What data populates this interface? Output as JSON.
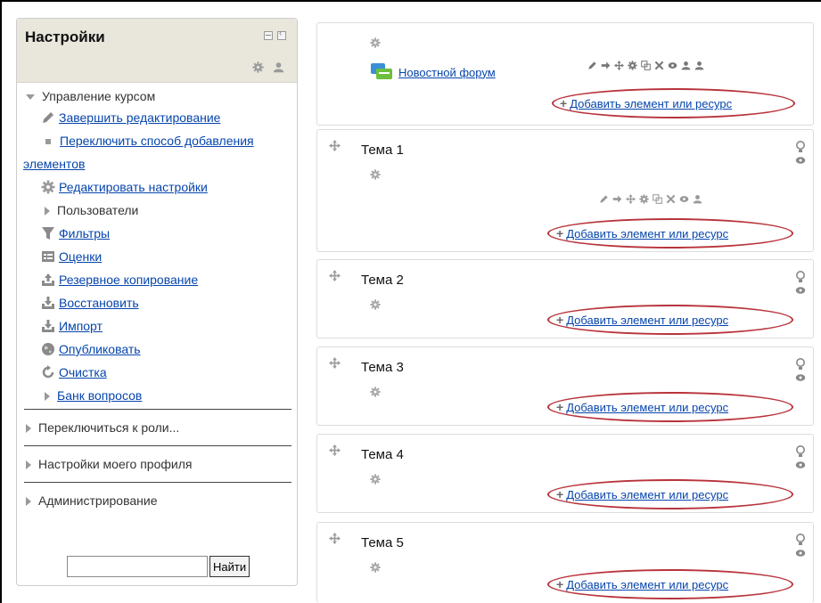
{
  "settings_block": {
    "title": "Настройки",
    "course_admin": {
      "label": "Управление курсом",
      "items": [
        {
          "label": "Завершить редактирование",
          "icon": "pencil-icon"
        },
        {
          "label": "Переключить способ добавления",
          "label_cont": "элементов",
          "icon": "square-bullet-icon"
        },
        {
          "label": "Редактировать настройки",
          "icon": "gear-icon"
        },
        {
          "label": "Пользователи",
          "icon": "expand-triangle-icon"
        },
        {
          "label": "Фильтры",
          "icon": "filter-icon"
        },
        {
          "label": "Оценки",
          "icon": "grades-table-icon"
        },
        {
          "label": "Резервное копирование",
          "icon": "backup-icon"
        },
        {
          "label": "Восстановить",
          "icon": "restore-icon"
        },
        {
          "label": "Импорт",
          "icon": "import-icon"
        },
        {
          "label": "Опубликовать",
          "icon": "publish-globe-icon"
        },
        {
          "label": "Очистка",
          "icon": "reset-icon"
        },
        {
          "label": "Банк вопросов",
          "icon": "expand-triangle-icon"
        }
      ]
    },
    "switch_role": "Переключиться к роли...",
    "profile_settings": "Настройки моего профиля",
    "administration": "Администрирование",
    "search": {
      "value": "",
      "button": "Найти"
    }
  },
  "course": {
    "add_link_label": "Добавить элемент или ресурс",
    "news_forum": "Новостной форум",
    "sections": [
      {
        "title": "Тема 1"
      },
      {
        "title": "Тема 2"
      },
      {
        "title": "Тема 3"
      },
      {
        "title": "Тема 4"
      },
      {
        "title": "Тема 5"
      }
    ]
  },
  "colors": {
    "header_bg": "#e9e6dc",
    "link": "#0645ad",
    "highlight_ellipse": "#b8333a"
  }
}
